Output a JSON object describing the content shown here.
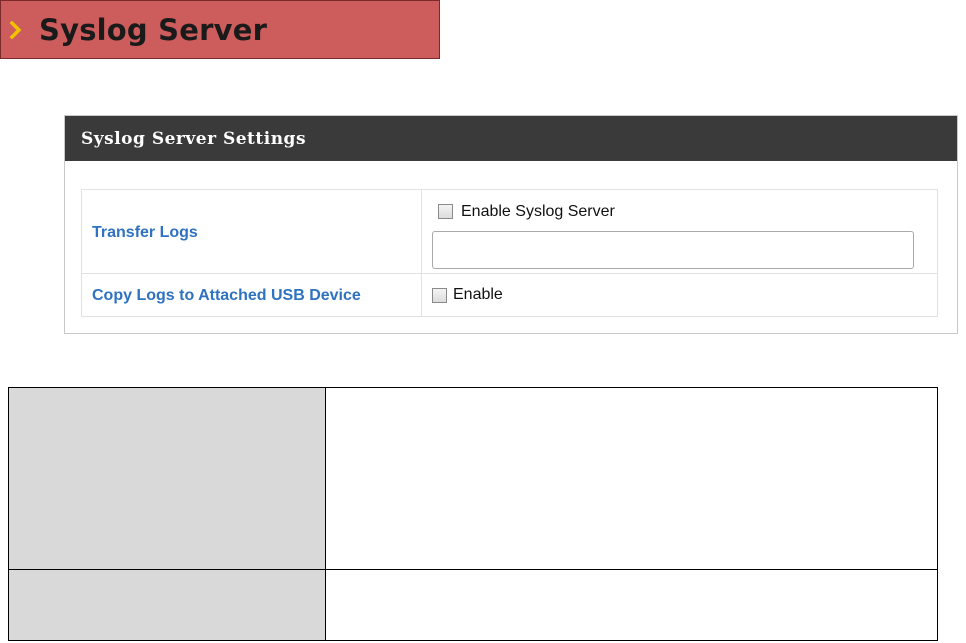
{
  "banner": {
    "title": "Syslog Server",
    "icon": "chevron-right-icon",
    "color": "#cd5c5c"
  },
  "panel": {
    "header": "Syslog Server Settings",
    "rows": [
      {
        "label": "Transfer Logs",
        "checkbox_label": "Enable Syslog Server",
        "checked": false,
        "input_value": ""
      },
      {
        "label": "Copy Logs to Attached USB Device",
        "checkbox_label": "Enable",
        "checked": false
      }
    ]
  },
  "description_table": {
    "rows": [
      {
        "left": "",
        "right": ""
      },
      {
        "left": "",
        "right": ""
      }
    ]
  },
  "colors": {
    "label_blue": "#2f72c0",
    "panel_header": "#3a3a3a",
    "table_gray": "#d9d9d9"
  }
}
